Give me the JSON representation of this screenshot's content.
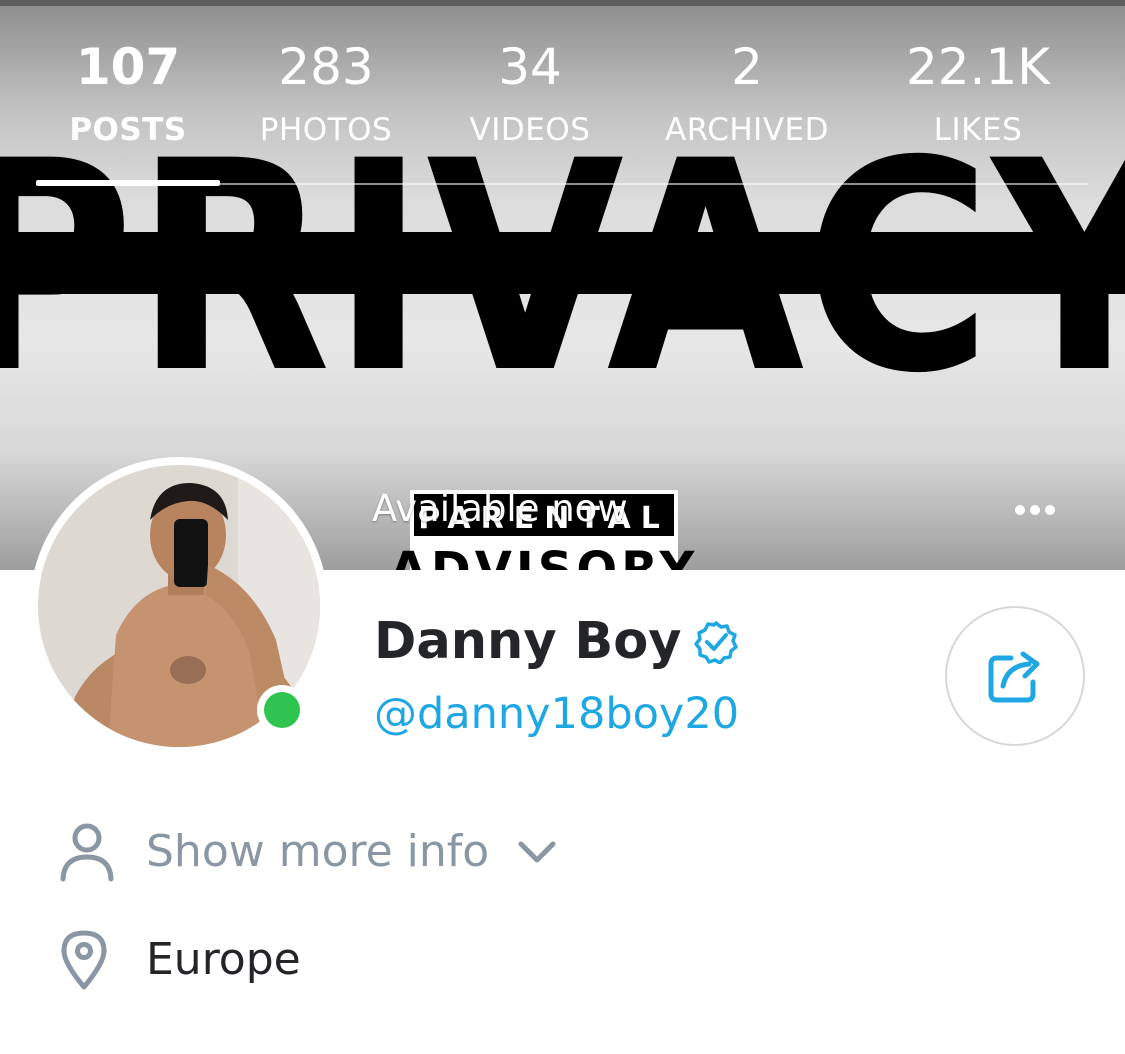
{
  "tabs": [
    {
      "count": "107",
      "label": "POSTS",
      "active": true
    },
    {
      "count": "283",
      "label": "PHOTOS"
    },
    {
      "count": "34",
      "label": "VIDEOS"
    },
    {
      "count": "2",
      "label": "ARCHIVED"
    },
    {
      "count": "22.1K",
      "label": "LIKES"
    }
  ],
  "cover": {
    "headline": "PRIVACY",
    "badge_line1": "PARENTAL",
    "badge_line2": "ADVISORY"
  },
  "status": {
    "available": "Available now"
  },
  "profile": {
    "name": "Danny Boy",
    "handle": "@danny18boy20",
    "verified": true,
    "online": true
  },
  "info": {
    "show_more_label": "Show more info",
    "location": "Europe"
  },
  "icons": {
    "more": "more-dots-icon",
    "verified": "verified-check-icon",
    "share": "share-icon",
    "person": "person-icon",
    "chevron": "chevron-down-icon",
    "location": "location-pin-icon"
  },
  "colors": {
    "accent": "#1ea7e3",
    "online": "#2fc44f",
    "text": "#242529",
    "muted": "#8a96a3"
  }
}
